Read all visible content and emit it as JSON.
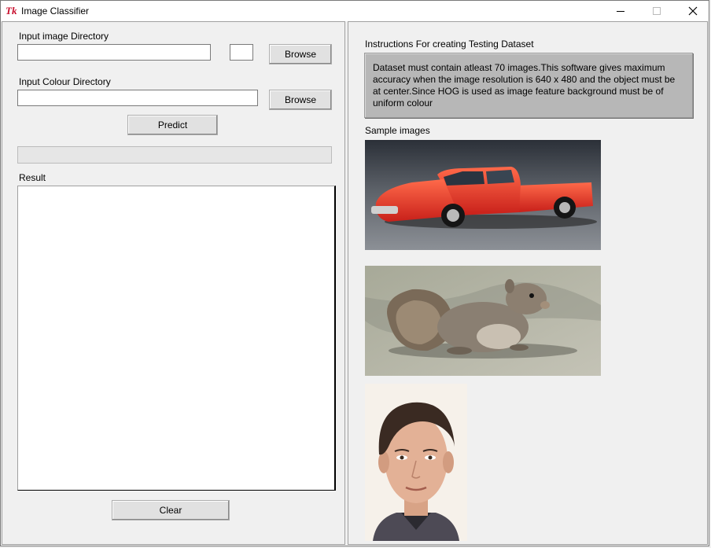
{
  "window": {
    "title": "Image Classifier",
    "icon": "tk-feather-icon"
  },
  "left": {
    "input_image_label": "Input image Directory",
    "input_image_value": "",
    "small_field_value": "",
    "browse1_label": "Browse",
    "input_colour_label": "Input Colour Directory",
    "input_colour_value": "",
    "browse2_label": "Browse",
    "predict_label": "Predict",
    "progress_fraction": 0,
    "result_label": "Result",
    "result_text": "",
    "clear_label": "Clear"
  },
  "right": {
    "instructions_heading": "Instructions For creating Testing Dataset",
    "instructions_text": "Dataset must contain atleast 70 images.This software gives maximum accuracy when the image resolution is 640 x 480 and the object must be at center.Since HOG is used as image feature background must be of uniform colour",
    "sample_label": "Sample images",
    "samples": [
      "red-pickup-truck",
      "squirrel",
      "face-portrait"
    ]
  },
  "colors": {
    "accent_red": "#e8352a",
    "instr_bg": "#b7b7b7"
  }
}
